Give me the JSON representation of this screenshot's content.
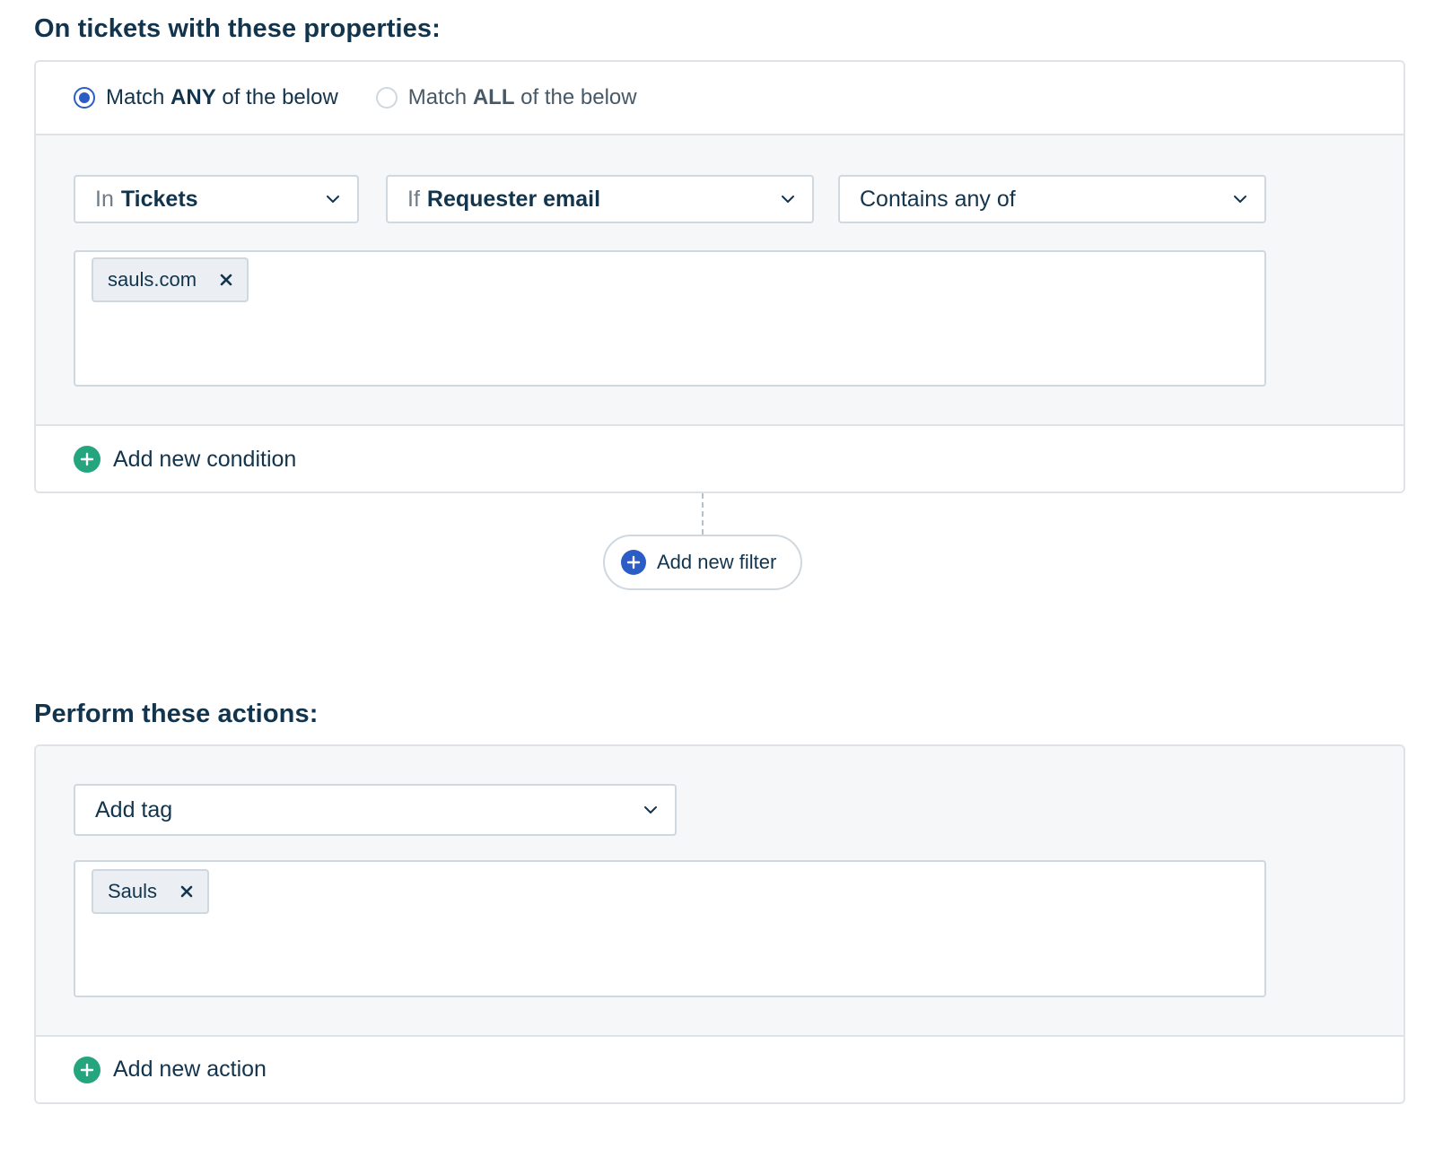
{
  "conditions_section": {
    "title": "On tickets with these properties:",
    "match_any": {
      "prefix": "Match ",
      "bold": "ANY",
      "suffix": " of the below",
      "selected": true
    },
    "match_all": {
      "prefix": "Match ",
      "bold": "ALL",
      "suffix": " of the below",
      "selected": false
    },
    "condition": {
      "scope_prefix": "In",
      "scope_value": "Tickets",
      "field_prefix": "If",
      "field_value": "Requester email",
      "operator_value": "Contains any of",
      "values": [
        "sauls.com"
      ]
    },
    "add_condition_label": "Add new condition",
    "add_filter_label": "Add new filter"
  },
  "actions_section": {
    "title": "Perform these actions:",
    "action_value": "Add tag",
    "tags": [
      "Sauls"
    ],
    "add_action_label": "Add new action"
  },
  "colors": {
    "primary_blue": "#2c5cc5",
    "add_green": "#24a57e",
    "text_dark": "#12344d",
    "border": "#cfd7df",
    "panel_bg": "#f5f7f9"
  },
  "icons": {
    "chevron": "chevron-down-icon",
    "remove": "close-icon",
    "add": "plus-circle-icon"
  }
}
